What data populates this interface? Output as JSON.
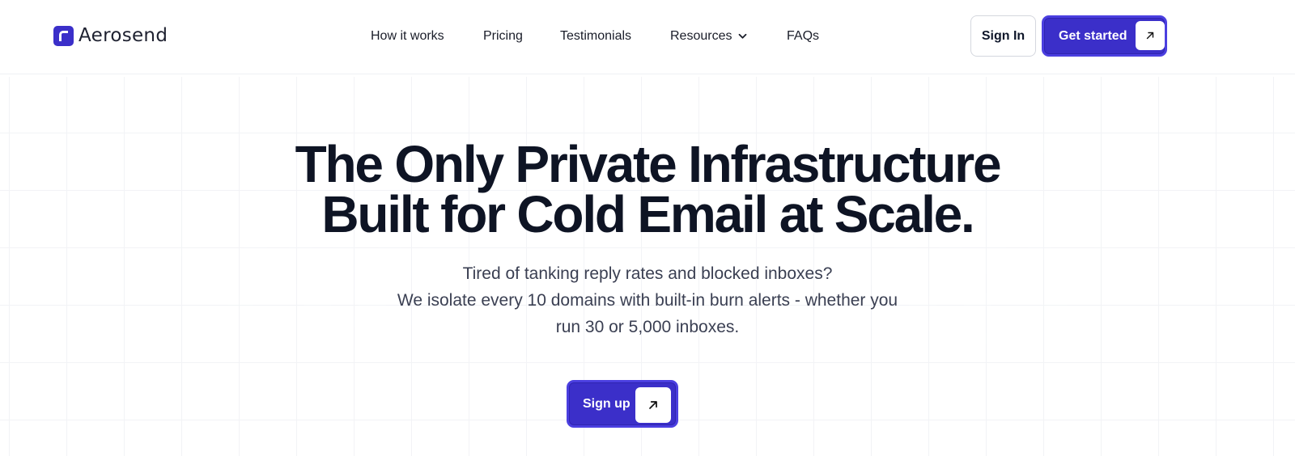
{
  "brand": {
    "name": "Aerosend",
    "accent": "#3b2fc9"
  },
  "nav": {
    "items": [
      {
        "label": "How it works"
      },
      {
        "label": "Pricing"
      },
      {
        "label": "Testimonials"
      },
      {
        "label": "Resources",
        "has_dropdown": true
      },
      {
        "label": "FAQs"
      }
    ]
  },
  "header_actions": {
    "sign_in": "Sign In",
    "get_started": "Get started"
  },
  "hero": {
    "title_line1": "The Only Private Infrastructure",
    "title_line2": "Built for Cold Email at Scale.",
    "subtitle_line1": "Tired of tanking reply rates and blocked inboxes?",
    "subtitle_line2": "We isolate every 10 domains with built-in burn alerts - whether you",
    "subtitle_line3": "run 30 or 5,000 inboxes.",
    "cta": "Sign up"
  },
  "icons": {
    "arrow": "arrow-up-right-icon",
    "chevron": "chevron-down-icon"
  }
}
